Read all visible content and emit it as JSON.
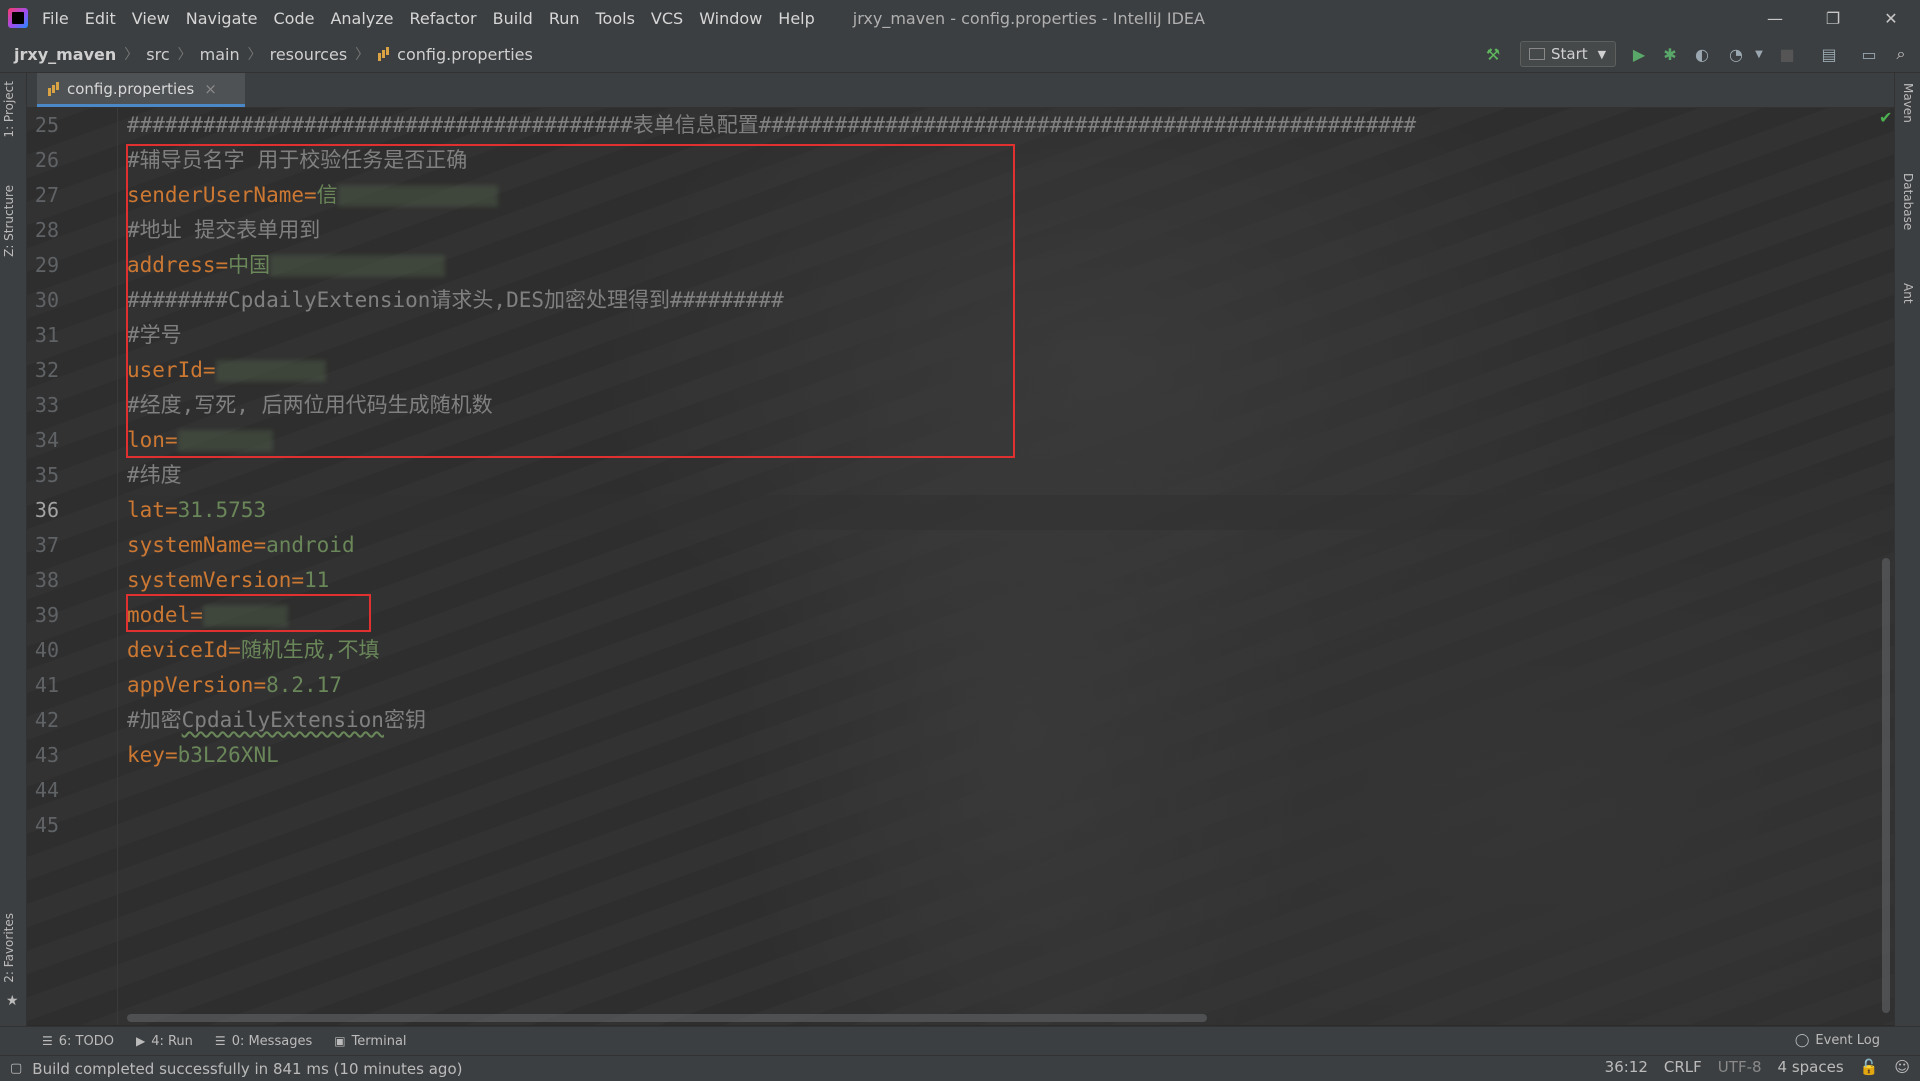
{
  "menu": {
    "items": [
      "File",
      "Edit",
      "View",
      "Navigate",
      "Code",
      "Analyze",
      "Refactor",
      "Build",
      "Run",
      "Tools",
      "VCS",
      "Window",
      "Help"
    ],
    "window_title": "jrxy_maven - config.properties - IntelliJ IDEA"
  },
  "window_controls": {
    "minimize": "—",
    "restore": "❐",
    "close": "✕"
  },
  "breadcrumb": {
    "project": "jrxy_maven",
    "items": [
      "src",
      "main",
      "resources"
    ],
    "file": "config.properties"
  },
  "toolbar": {
    "run_config": "Start"
  },
  "left_strip": {
    "project": "1: Project",
    "structure": "Z: Structure",
    "favorites": "2: Favorites"
  },
  "right_strip": {
    "maven": "Maven",
    "database": "Database",
    "ant": "Ant"
  },
  "tab": {
    "label": "config.properties",
    "close": "×"
  },
  "editor": {
    "current_line": 36,
    "lines": [
      {
        "no": "25",
        "type": "comment",
        "text": "########################################表单信息配置####################################################"
      },
      {
        "no": "26",
        "type": "comment",
        "text": "#辅导员名字 用于校验任务是否正确"
      },
      {
        "no": "27",
        "type": "kv",
        "key": "senderUserName",
        "value": "信"
      },
      {
        "no": "28",
        "type": "comment",
        "text": "#地址 提交表单用到"
      },
      {
        "no": "29",
        "type": "kv",
        "key": "address",
        "value": "中国"
      },
      {
        "no": "30",
        "type": "comment",
        "text": "########CpdailyExtension请求头,DES加密处理得到#########"
      },
      {
        "no": "31",
        "type": "comment",
        "text": "#学号"
      },
      {
        "no": "32",
        "type": "kv",
        "key": "userId",
        "value": ""
      },
      {
        "no": "33",
        "type": "comment",
        "text": "#经度,写死, 后两位用代码生成随机数"
      },
      {
        "no": "34",
        "type": "kv",
        "key": "lon",
        "value": ""
      },
      {
        "no": "35",
        "type": "comment",
        "text": "#纬度"
      },
      {
        "no": "36",
        "type": "kv",
        "key": "lat",
        "value": "31.5753"
      },
      {
        "no": "37",
        "type": "kv",
        "key": "systemName",
        "value": "android"
      },
      {
        "no": "38",
        "type": "kv",
        "key": "systemVersion",
        "value": "11"
      },
      {
        "no": "39",
        "type": "kv",
        "key": "model",
        "value": ""
      },
      {
        "no": "40",
        "type": "kv",
        "key": "deviceId",
        "value": "随机生成,不填"
      },
      {
        "no": "41",
        "type": "kv",
        "key": "appVersion",
        "value": "8.2.17"
      },
      {
        "no": "42",
        "type": "comment",
        "text": "#加密CpdailyExtension密钥"
      },
      {
        "no": "43",
        "type": "kv",
        "key": "key",
        "value": "b3L26XNL"
      },
      {
        "no": "44",
        "type": "empty"
      },
      {
        "no": "45",
        "type": "empty"
      }
    ]
  },
  "bottom_tools": {
    "todo": "6: TODO",
    "run": "4: Run",
    "messages": "0: Messages",
    "terminal": "Terminal",
    "event_log": "Event Log"
  },
  "status": {
    "message": "Build completed successfully in 841 ms (10 minutes ago)",
    "position": "36:12",
    "line_sep": "CRLF",
    "encoding": "UTF-8",
    "indent": "4 spaces"
  },
  "colors": {
    "accent": "#4a88c7",
    "key": "#cc7832",
    "value": "#6a8759",
    "comment": "#808080",
    "annotation": "#e03030"
  }
}
